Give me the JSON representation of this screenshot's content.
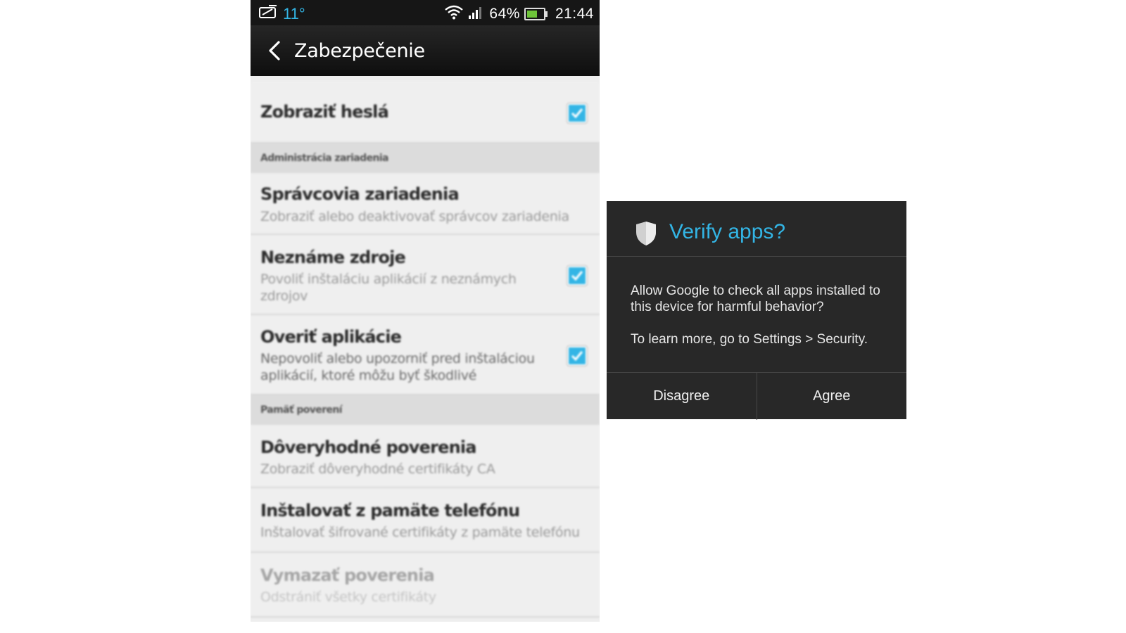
{
  "status_bar": {
    "temperature": "11°",
    "battery_percent": "64%",
    "battery_level": 0.64,
    "time": "21:44"
  },
  "action_bar": {
    "title": "Zabezpečenie"
  },
  "settings": {
    "show_passwords": {
      "title": "Zobraziť heslá",
      "checked": true
    },
    "section_device_admin": "Administrácia zariadenia",
    "device_admins": {
      "title": "Správcovia zariadenia",
      "subtitle": "Zobraziť alebo deaktivovať správcov zariadenia"
    },
    "unknown_sources": {
      "title": "Neznáme zdroje",
      "subtitle": "Povoliť inštaláciu aplikácií z neznámych zdrojov",
      "checked": true
    },
    "verify_apps": {
      "title": "Overiť aplikácie",
      "subtitle": "Nepovoliť alebo upozorniť pred inštaláciou aplikácií, ktoré môžu byť škodlivé",
      "checked": true
    },
    "section_credential_storage": "Pamäť poverení",
    "trusted_credentials": {
      "title": "Dôveryhodné poverenia",
      "subtitle": "Zobraziť dôveryhodné certifikáty CA"
    },
    "install_from_storage": {
      "title": "Inštalovať z pamäte telefónu",
      "subtitle": "Inštalovať šifrované certifikáty z pamäte telefónu"
    },
    "clear_credentials": {
      "title": "Vymazať poverenia",
      "subtitle": "Odstrániť všetky certifikáty"
    }
  },
  "dialog": {
    "icon": "shield-icon",
    "title": "Verify apps?",
    "message": "Allow Google to check all apps installed to this device for harmful behavior?",
    "note": "To learn more, go to Settings > Security.",
    "disagree_label": "Disagree",
    "agree_label": "Agree"
  },
  "colors": {
    "accent": "#33b5e5",
    "dialog_bg": "#282828",
    "status_bar_bg": "#161616"
  }
}
